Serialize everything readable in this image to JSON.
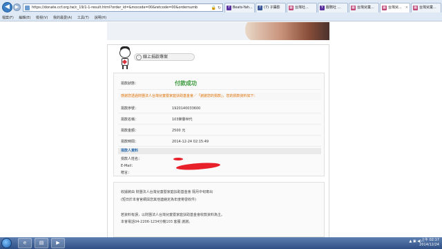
{
  "browser": {
    "url": "https://donate.ccf.org.tw/c_19/1-1-result.html?order_id=&mocode=00&retcode=00&ordernumber=1920140033...",
    "tabs": [
      {
        "label": "Beats-Yah...",
        "icon": "Y",
        "color": "#5a2fa0"
      },
      {
        "label": "(7) 子攝影",
        "icon": "f",
        "color": "#3b5998"
      },
      {
        "label": "台灣社...",
        "icon": "▦",
        "color": "#c04a7a"
      },
      {
        "label": "服務社 ...",
        "icon": "Y",
        "color": "#5a2fa0"
      },
      {
        "label": "台灣兒童...",
        "icon": "▦",
        "color": "#c04a7a"
      },
      {
        "label": "台灣兒...",
        "icon": "▦",
        "color": "#c04a7a"
      },
      {
        "label": "台灣兒童...",
        "icon": "▦",
        "color": "#c04a7a"
      }
    ],
    "menu": [
      "檔案(F)",
      "編輯(E)",
      "檢視(V)",
      "我的最愛(A)",
      "工具(T)",
      "說明(H)"
    ]
  },
  "donation": {
    "section_tag": "線上捐款專案",
    "rows": [
      {
        "label": "捐款狀態：",
        "value": "付款成功"
      },
      {
        "label": "捐款序號：",
        "value": "1920140033600"
      },
      {
        "label": "捐款名稱：",
        "value": "103榮譽世代"
      },
      {
        "label": "捐款金額：",
        "value": "2500 元"
      },
      {
        "label": "捐款時間：",
        "value": "2014-12-24 02:15:49"
      }
    ],
    "notice": "感謝您透過財團法人台灣兒童暨家庭扶助基金會／「謝謝您的捐款」，您的捐款資料如下：",
    "donor_section": "捐款人資料",
    "donor_rows": [
      {
        "label": "捐款人姓名：",
        "value": ""
      },
      {
        "label": "E-Mail：",
        "value": ""
      },
      {
        "label": "贈言：",
        "value": ""
      }
    ]
  },
  "footer": {
    "lines": [
      "收據將由 財團法人台灣兒童暨家庭扶助基金會 隔月中旬寄出",
      "(短日於本會官網與您其他連絡定為年度寄發收件)",
      "",
      "若資料有誤，以財團法人台灣兒童暨家庭扶助基金會收款資料為主。",
      "本會電話04-2206-1234分機103 客服 謝謝。"
    ]
  },
  "taskbar": {
    "time": "上午 02:17",
    "date": "2014/12/24"
  },
  "colors": {
    "success": "#3a9a3a",
    "notice": "#e07000",
    "section": "#2a6db0",
    "redact": "#e8202a"
  }
}
